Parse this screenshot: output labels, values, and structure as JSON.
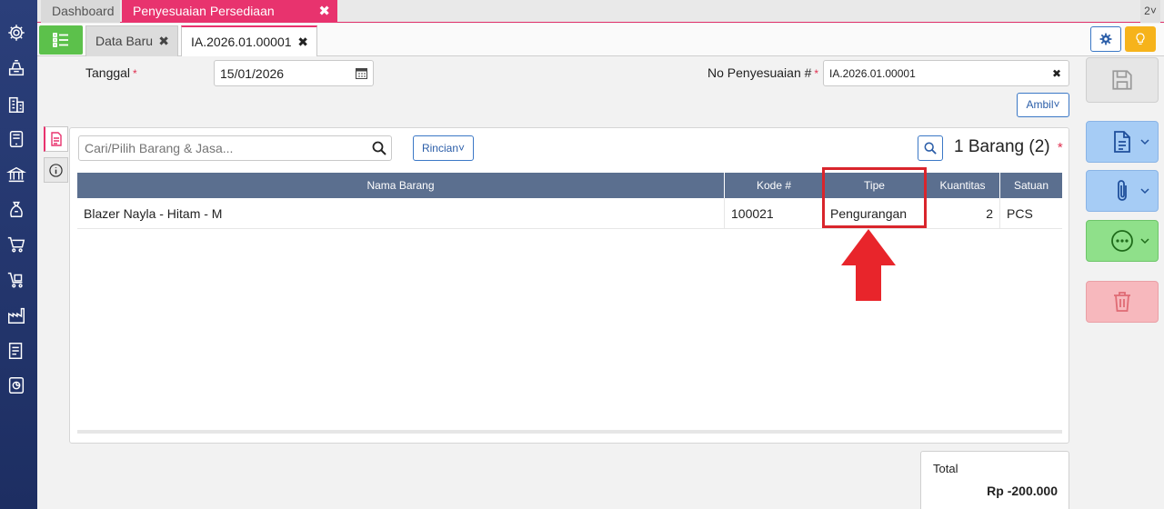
{
  "top_tabs": [
    {
      "label": "Dashboard"
    },
    {
      "label": "Penyesuaian Persediaan",
      "close": "✖"
    }
  ],
  "pager": {
    "label": "2"
  },
  "doc_tabs": [
    {
      "label": "Data Baru",
      "close": "✖"
    },
    {
      "label": "IA.2026.01.00001",
      "close": "✖"
    }
  ],
  "form": {
    "tanggal_label": "Tanggal",
    "tanggal_value": "15/01/2026",
    "no_label": "No Penyesuaian #",
    "no_value": "IA.2026.01.00001",
    "required_mark": "*",
    "clear_icon": "✖",
    "ambil_label": "Ambil"
  },
  "panel": {
    "search_placeholder": "Cari/Pilih Barang & Jasa...",
    "rincian_label": "Rincian",
    "count_label": "1 Barang (2)",
    "count_mark": "*"
  },
  "table": {
    "columns": [
      "Nama Barang",
      "Kode #",
      "Tipe",
      "Kuantitas",
      "Satuan"
    ],
    "rows": [
      {
        "nama": "Blazer Nayla - Hitam - M",
        "kode": "100021",
        "tipe": "Pengurangan",
        "kuantitas": "2",
        "satuan": "PCS"
      }
    ]
  },
  "total": {
    "label": "Total",
    "value": "Rp -200.000"
  },
  "colors": {
    "sidebar": "#23386e",
    "accent_pink": "#e8336e",
    "table_header": "#5b6f8f",
    "highlight_red": "#d9252c",
    "save_green": "#5cc14b"
  },
  "icons": {
    "sidebar": [
      "gear-icon",
      "cash-register-icon",
      "building-icon",
      "tablet-icon",
      "bank-icon",
      "money-bag-icon",
      "cart-icon",
      "cart-box-icon",
      "factory-icon",
      "tax-icon",
      "report-icon"
    ],
    "actions": [
      "save-icon",
      "document-icon",
      "paperclip-icon",
      "more-icon",
      "trash-icon"
    ]
  }
}
